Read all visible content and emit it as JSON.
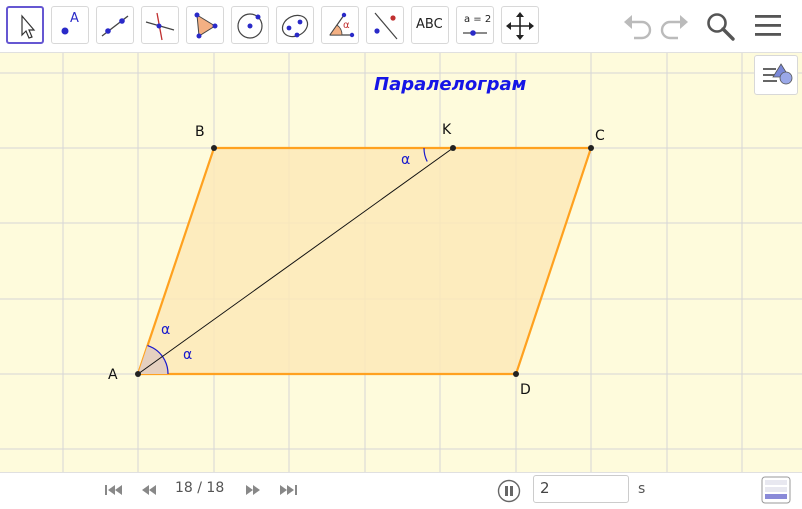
{
  "toolbar": {
    "tools": [
      {
        "name": "move",
        "icon": "cursor-arrow-icon"
      },
      {
        "name": "point",
        "icon": "point-icon",
        "glyph": "A"
      },
      {
        "name": "line",
        "icon": "line-icon"
      },
      {
        "name": "perpendicular-line",
        "icon": "perpendicular-line-icon"
      },
      {
        "name": "polygon",
        "icon": "polygon-icon"
      },
      {
        "name": "circle",
        "icon": "circle-icon"
      },
      {
        "name": "conic",
        "icon": "ellipse-icon"
      },
      {
        "name": "angle",
        "icon": "angle-icon",
        "glyph": "α"
      },
      {
        "name": "reflect",
        "icon": "reflect-icon"
      },
      {
        "name": "text",
        "icon": "text-icon",
        "glyph": "ABC"
      },
      {
        "name": "slider",
        "icon": "slider-icon",
        "glyph": "a = 2"
      },
      {
        "name": "move-graphics",
        "icon": "move-arrows-icon"
      }
    ],
    "right": [
      "undo-icon",
      "redo-icon",
      "search-icon",
      "menu-icon"
    ]
  },
  "graphics": {
    "title": "Паралелограм",
    "points": {
      "A": "A",
      "B": "B",
      "C": "C",
      "D": "D",
      "K": "K"
    },
    "angle_symbol": "α",
    "colors": {
      "background": "#fefbdc",
      "grid": "#d6d6d6",
      "polygon_fill": "#fde9b8",
      "polygon_stroke": "#ffa11f",
      "angle_label": "#1a1acc",
      "title": "#1515e6"
    }
  },
  "bottom_bar": {
    "slide_counter": "18 / 18",
    "speed_value": "2",
    "speed_unit": "s"
  }
}
